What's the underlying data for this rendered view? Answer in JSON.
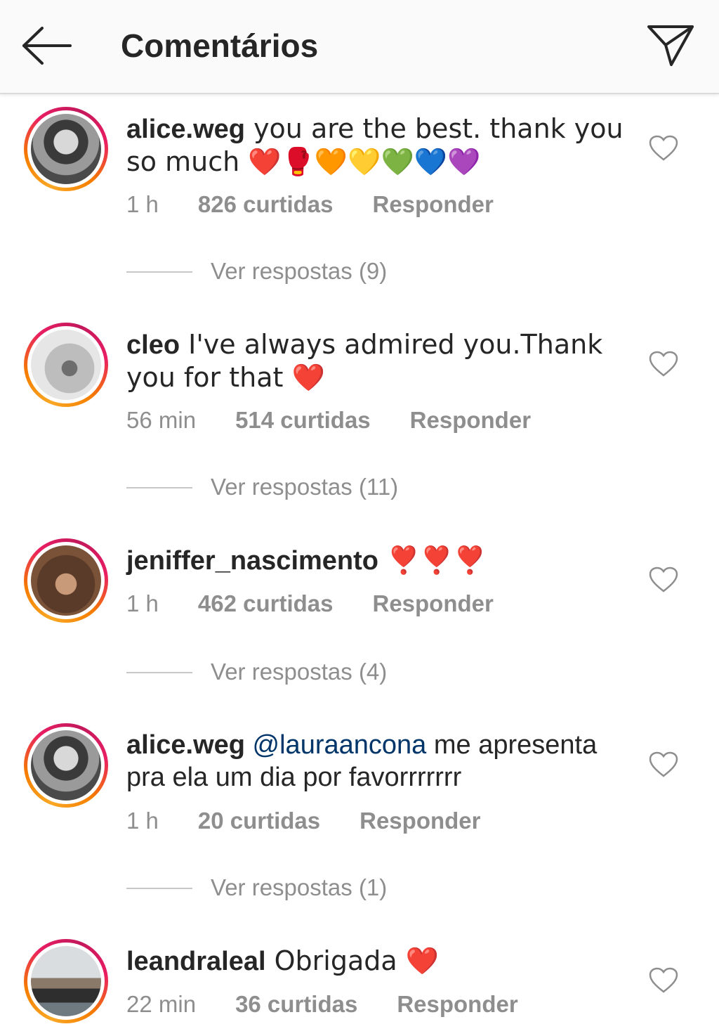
{
  "header": {
    "title": "Comentários"
  },
  "comments": [
    {
      "username": "alice.weg",
      "mention": "",
      "text": " you are the best. thank you so much ❤️🥊🧡💛💚💙💜",
      "time": "1 h",
      "likes": "826 curtidas",
      "reply_label": "Responder",
      "view_replies": "Ver respostas (9)"
    },
    {
      "username": "cleo",
      "mention": "",
      "text": " I've always admired you.Thank you for that ❤️",
      "time": "56 min",
      "likes": "514 curtidas",
      "reply_label": "Responder",
      "view_replies": "Ver respostas (11)"
    },
    {
      "username": "jeniffer_nascimento",
      "mention": "",
      "text": " ❣️❣️❣️",
      "time": "1 h",
      "likes": "462 curtidas",
      "reply_label": "Responder",
      "view_replies": "Ver respostas (4)"
    },
    {
      "username": "alice.weg",
      "mention": " @lauraancona",
      "text": " me apresenta pra ela um dia por favorrrrrrr",
      "time": "1 h",
      "likes": "20 curtidas",
      "reply_label": "Responder",
      "view_replies": "Ver respostas (1)"
    },
    {
      "username": "leandraleal",
      "mention": "",
      "text": " Obrigada ❤️",
      "time": "22 min",
      "likes": "36 curtidas",
      "reply_label": "Responder",
      "view_replies": ""
    }
  ],
  "colors": {
    "text": "#262626",
    "muted": "#8e8e8e",
    "mention": "#003569",
    "story_ring_start": "#f9a825",
    "story_ring_end": "#e91e63"
  }
}
